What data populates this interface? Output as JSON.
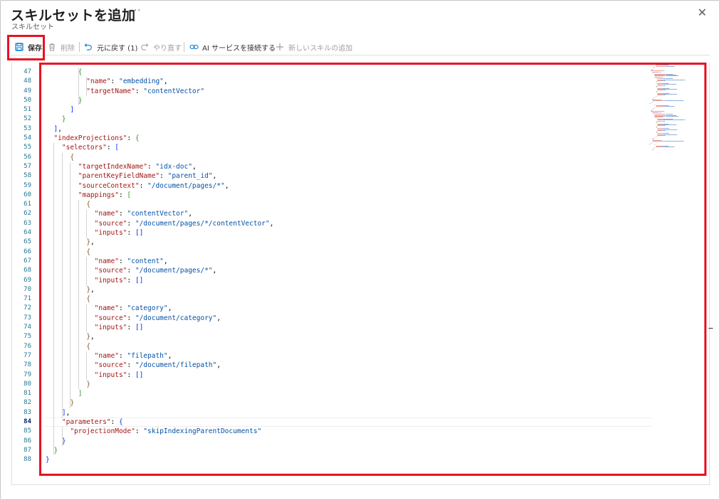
{
  "header": {
    "title": "スキルセットを追加",
    "more": "···",
    "subtitle": "スキルセット",
    "close": "✕"
  },
  "toolbar": {
    "save": "保存",
    "delete": "削除",
    "undo": "元に戻す (1)",
    "redo": "やり直す",
    "connect_ai": "AI サービスを接続する",
    "add_skill": "新しいスキルの追加"
  },
  "editor": {
    "active_line": 84,
    "lines": [
      {
        "n": "47",
        "indent": 8,
        "tokens": [
          [
            "bg",
            "{"
          ]
        ]
      },
      {
        "n": "48",
        "indent": 10,
        "tokens": [
          [
            "k",
            "\"name\""
          ],
          [
            "p",
            ": "
          ],
          [
            "s",
            "\"embedding\""
          ],
          [
            "p",
            ","
          ]
        ]
      },
      {
        "n": "49",
        "indent": 10,
        "tokens": [
          [
            "k",
            "\"targetName\""
          ],
          [
            "p",
            ": "
          ],
          [
            "s",
            "\"contentVector\""
          ]
        ]
      },
      {
        "n": "50",
        "indent": 8,
        "tokens": [
          [
            "bg",
            "}"
          ]
        ]
      },
      {
        "n": "51",
        "indent": 6,
        "tokens": [
          [
            "bb",
            "]"
          ]
        ]
      },
      {
        "n": "52",
        "indent": 4,
        "tokens": [
          [
            "bg",
            "}"
          ]
        ]
      },
      {
        "n": "53",
        "indent": 2,
        "tokens": [
          [
            "bb",
            "]"
          ],
          [
            "p",
            ","
          ]
        ]
      },
      {
        "n": "54",
        "indent": 2,
        "tokens": [
          [
            "k",
            "\"indexProjections\""
          ],
          [
            "p",
            ": "
          ],
          [
            "bg",
            "{"
          ]
        ]
      },
      {
        "n": "55",
        "indent": 4,
        "tokens": [
          [
            "k",
            "\"selectors\""
          ],
          [
            "p",
            ": "
          ],
          [
            "bb",
            "["
          ]
        ]
      },
      {
        "n": "56",
        "indent": 6,
        "tokens": [
          [
            "by",
            "{"
          ]
        ]
      },
      {
        "n": "57",
        "indent": 8,
        "tokens": [
          [
            "k",
            "\"targetIndexName\""
          ],
          [
            "p",
            ": "
          ],
          [
            "s",
            "\"idx-doc\""
          ],
          [
            "p",
            ","
          ]
        ]
      },
      {
        "n": "58",
        "indent": 8,
        "tokens": [
          [
            "k",
            "\"parentKeyFieldName\""
          ],
          [
            "p",
            ": "
          ],
          [
            "s",
            "\"parent_id\""
          ],
          [
            "p",
            ","
          ]
        ]
      },
      {
        "n": "59",
        "indent": 8,
        "tokens": [
          [
            "k",
            "\"sourceContext\""
          ],
          [
            "p",
            ": "
          ],
          [
            "s",
            "\"/document/pages/*\""
          ],
          [
            "p",
            ","
          ]
        ]
      },
      {
        "n": "60",
        "indent": 8,
        "tokens": [
          [
            "k",
            "\"mappings\""
          ],
          [
            "p",
            ": "
          ],
          [
            "bg",
            "["
          ]
        ]
      },
      {
        "n": "61",
        "indent": 10,
        "tokens": [
          [
            "by",
            "{"
          ]
        ]
      },
      {
        "n": "62",
        "indent": 12,
        "tokens": [
          [
            "k",
            "\"name\""
          ],
          [
            "p",
            ": "
          ],
          [
            "s",
            "\"contentVector\""
          ],
          [
            "p",
            ","
          ]
        ]
      },
      {
        "n": "63",
        "indent": 12,
        "tokens": [
          [
            "k",
            "\"source\""
          ],
          [
            "p",
            ": "
          ],
          [
            "s",
            "\"/document/pages/*/contentVector\""
          ],
          [
            "p",
            ","
          ]
        ]
      },
      {
        "n": "64",
        "indent": 12,
        "tokens": [
          [
            "k",
            "\"inputs\""
          ],
          [
            "p",
            ": "
          ],
          [
            "bb",
            "[]"
          ]
        ]
      },
      {
        "n": "65",
        "indent": 10,
        "tokens": [
          [
            "by",
            "}"
          ],
          [
            "p",
            ","
          ]
        ]
      },
      {
        "n": "66",
        "indent": 10,
        "tokens": [
          [
            "by",
            "{"
          ]
        ]
      },
      {
        "n": "67",
        "indent": 12,
        "tokens": [
          [
            "k",
            "\"name\""
          ],
          [
            "p",
            ": "
          ],
          [
            "s",
            "\"content\""
          ],
          [
            "p",
            ","
          ]
        ]
      },
      {
        "n": "68",
        "indent": 12,
        "tokens": [
          [
            "k",
            "\"source\""
          ],
          [
            "p",
            ": "
          ],
          [
            "s",
            "\"/document/pages/*\""
          ],
          [
            "p",
            ","
          ]
        ]
      },
      {
        "n": "69",
        "indent": 12,
        "tokens": [
          [
            "k",
            "\"inputs\""
          ],
          [
            "p",
            ": "
          ],
          [
            "bb",
            "[]"
          ]
        ]
      },
      {
        "n": "70",
        "indent": 10,
        "tokens": [
          [
            "by",
            "}"
          ],
          [
            "p",
            ","
          ]
        ]
      },
      {
        "n": "71",
        "indent": 10,
        "tokens": [
          [
            "by",
            "{"
          ]
        ]
      },
      {
        "n": "72",
        "indent": 12,
        "tokens": [
          [
            "k",
            "\"name\""
          ],
          [
            "p",
            ": "
          ],
          [
            "s",
            "\"category\""
          ],
          [
            "p",
            ","
          ]
        ]
      },
      {
        "n": "73",
        "indent": 12,
        "tokens": [
          [
            "k",
            "\"source\""
          ],
          [
            "p",
            ": "
          ],
          [
            "s",
            "\"/document/category\""
          ],
          [
            "p",
            ","
          ]
        ]
      },
      {
        "n": "74",
        "indent": 12,
        "tokens": [
          [
            "k",
            "\"inputs\""
          ],
          [
            "p",
            ": "
          ],
          [
            "bb",
            "[]"
          ]
        ]
      },
      {
        "n": "75",
        "indent": 10,
        "tokens": [
          [
            "by",
            "}"
          ],
          [
            "p",
            ","
          ]
        ]
      },
      {
        "n": "76",
        "indent": 10,
        "tokens": [
          [
            "by",
            "{"
          ]
        ]
      },
      {
        "n": "77",
        "indent": 12,
        "tokens": [
          [
            "k",
            "\"name\""
          ],
          [
            "p",
            ": "
          ],
          [
            "s",
            "\"filepath\""
          ],
          [
            "p",
            ","
          ]
        ]
      },
      {
        "n": "78",
        "indent": 12,
        "tokens": [
          [
            "k",
            "\"source\""
          ],
          [
            "p",
            ": "
          ],
          [
            "s",
            "\"/document/filepath\""
          ],
          [
            "p",
            ","
          ]
        ]
      },
      {
        "n": "79",
        "indent": 12,
        "tokens": [
          [
            "k",
            "\"inputs\""
          ],
          [
            "p",
            ": "
          ],
          [
            "bb",
            "[]"
          ]
        ]
      },
      {
        "n": "80",
        "indent": 10,
        "tokens": [
          [
            "by",
            "}"
          ]
        ]
      },
      {
        "n": "81",
        "indent": 8,
        "tokens": [
          [
            "bg",
            "]"
          ]
        ]
      },
      {
        "n": "82",
        "indent": 6,
        "tokens": [
          [
            "by",
            "}"
          ]
        ]
      },
      {
        "n": "83",
        "indent": 4,
        "tokens": [
          [
            "bb",
            "]"
          ],
          [
            "p",
            ","
          ]
        ]
      },
      {
        "n": "84",
        "indent": 4,
        "tokens": [
          [
            "k",
            "\"parameters\""
          ],
          [
            "p",
            ": "
          ],
          [
            "bb",
            "{"
          ]
        ]
      },
      {
        "n": "85",
        "indent": 6,
        "tokens": [
          [
            "k",
            "\"projectionMode\""
          ],
          [
            "p",
            ": "
          ],
          [
            "s",
            "\"skipIndexingParentDocuments\""
          ]
        ]
      },
      {
        "n": "86",
        "indent": 4,
        "tokens": [
          [
            "bb",
            "}"
          ]
        ]
      },
      {
        "n": "87",
        "indent": 2,
        "tokens": [
          [
            "bg",
            "}"
          ]
        ]
      },
      {
        "n": "88",
        "indent": 0,
        "tokens": [
          [
            "bb",
            "}"
          ]
        ]
      }
    ]
  },
  "colors": {
    "highlight": "#e81123",
    "json_key": "#a31515",
    "json_string": "#0451a5",
    "line_number": "#237893"
  }
}
